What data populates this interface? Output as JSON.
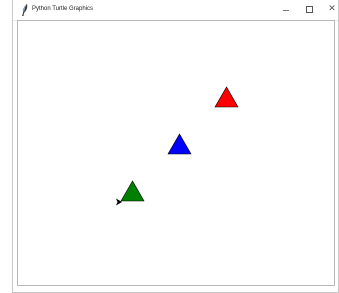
{
  "window": {
    "title": "Python Turtle Graphics",
    "controls": {
      "minimize_icon": "minimize-icon",
      "maximize_icon": "maximize-icon",
      "close_glyph": "✕"
    }
  },
  "canvas": {
    "background": "#ffffff",
    "shapes": [
      {
        "name": "red-triangle",
        "color": "#ff0000"
      },
      {
        "name": "blue-triangle",
        "color": "#0000ff"
      },
      {
        "name": "green-triangle",
        "color": "#008000"
      }
    ],
    "turtle": {
      "name": "turtle-cursor",
      "color": "#000000",
      "heading": "east"
    }
  }
}
